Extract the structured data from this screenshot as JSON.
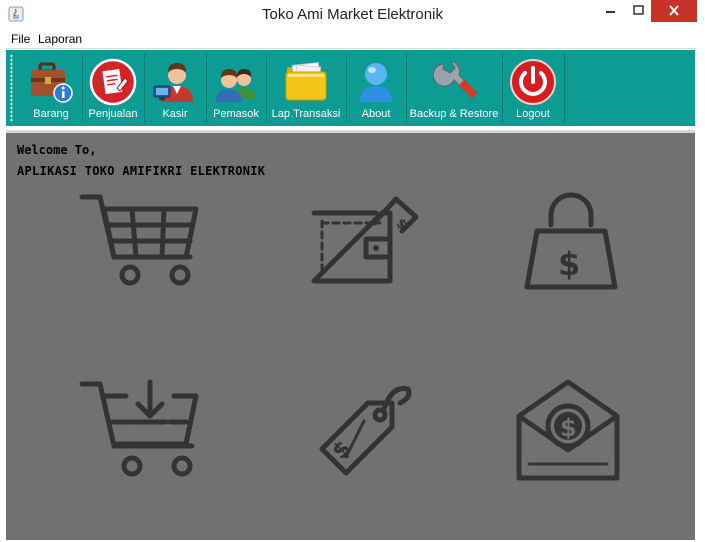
{
  "window": {
    "title": "Toko Ami Market Elektronik"
  },
  "menu": {
    "items": [
      "File",
      "Laporan"
    ]
  },
  "toolbar": {
    "buttons": [
      {
        "label": "Barang",
        "icon": "briefcase-info-icon"
      },
      {
        "label": "Penjualan",
        "icon": "sales-document-icon"
      },
      {
        "label": "Kasir",
        "icon": "cashier-user-icon"
      },
      {
        "label": "Pemasok",
        "icon": "suppliers-users-icon"
      },
      {
        "label": "Lap.Transaksi",
        "icon": "transaction-folder-icon"
      },
      {
        "label": "About",
        "icon": "about-user-icon"
      },
      {
        "label": "Backup & Restore",
        "icon": "wrench-icon"
      },
      {
        "label": "Logout",
        "icon": "power-icon"
      }
    ]
  },
  "main": {
    "welcome": "Welcome To,",
    "app_name": "APLIKASI TOKO AMIFIKRI ELEKTRONIK",
    "icons": [
      "shopping-cart-icon",
      "wallet-icon",
      "shopping-bag-dollar-icon",
      "cart-download-icon",
      "price-tag-icon",
      "envelope-dollar-icon"
    ]
  },
  "colors": {
    "toolbar": "#0c9c94",
    "content": "#717171",
    "icon_stroke": "#333333",
    "close": "#c7332b"
  }
}
